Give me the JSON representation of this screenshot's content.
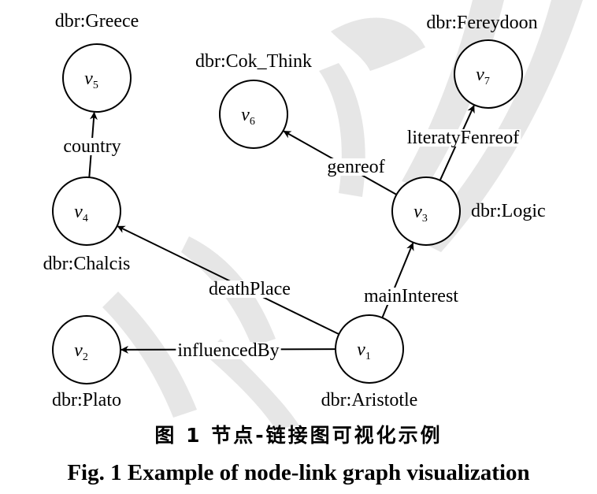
{
  "nodes": [
    {
      "id": "v1",
      "main": "v",
      "sub": "1",
      "label": "dbr:Aristotle"
    },
    {
      "id": "v2",
      "main": "v",
      "sub": "2",
      "label": "dbr:Plato"
    },
    {
      "id": "v3",
      "main": "v",
      "sub": "3",
      "label": "dbr:Logic"
    },
    {
      "id": "v4",
      "main": "v",
      "sub": "4",
      "label": "dbr:Chalcis"
    },
    {
      "id": "v5",
      "main": "v",
      "sub": "5",
      "label": "dbr:Greece"
    },
    {
      "id": "v6",
      "main": "v",
      "sub": "6",
      "label": "dbr:Cok_Think"
    },
    {
      "id": "v7",
      "main": "v",
      "sub": "7",
      "label": "dbr:Fereydoon"
    }
  ],
  "edges": [
    {
      "from": "v1",
      "to": "v2",
      "label": "influencedBy"
    },
    {
      "from": "v1",
      "to": "v4",
      "label": "deathPlace"
    },
    {
      "from": "v1",
      "to": "v3",
      "label": "mainInterest"
    },
    {
      "from": "v4",
      "to": "v5",
      "label": "country"
    },
    {
      "from": "v3",
      "to": "v6",
      "label": "genreof"
    },
    {
      "from": "v3",
      "to": "v7",
      "label": "literatyFenreof"
    }
  ],
  "caption": {
    "cn": "图 1   节点-链接图可视化示例",
    "en": "Fig. 1    Example of node-link graph visualization"
  }
}
